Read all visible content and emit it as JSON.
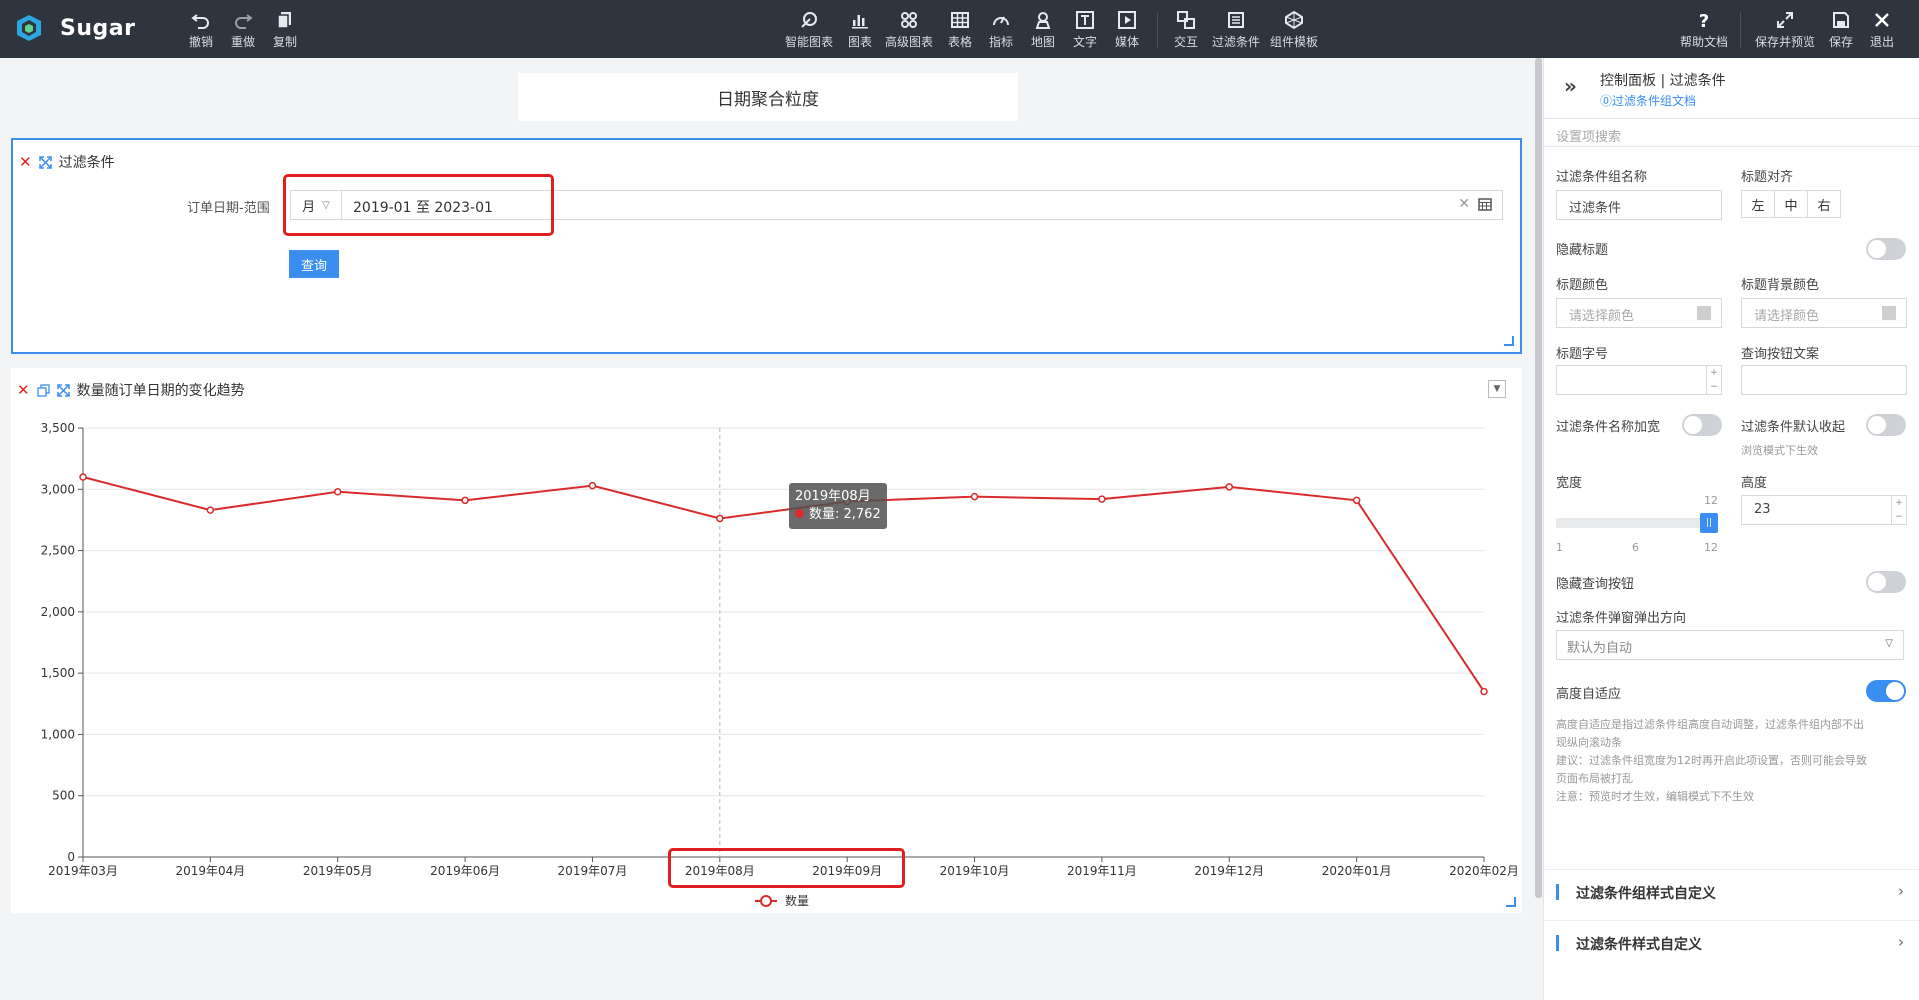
{
  "app": {
    "name": "Sugar"
  },
  "toolbar": {
    "left": [
      {
        "label": "撤销",
        "icon": "undo-icon"
      },
      {
        "label": "重做",
        "icon": "redo-icon"
      },
      {
        "label": "复制",
        "icon": "copy-icon"
      }
    ],
    "center": [
      {
        "label": "智能图表",
        "icon": "smart-chart-icon"
      },
      {
        "label": "图表",
        "icon": "bar-chart-icon"
      },
      {
        "label": "高级图表",
        "icon": "advanced-chart-icon"
      },
      {
        "label": "表格",
        "icon": "table-icon"
      },
      {
        "label": "指标",
        "icon": "gauge-icon"
      },
      {
        "label": "地图",
        "icon": "map-pin-icon"
      },
      {
        "label": "文字",
        "icon": "text-icon"
      },
      {
        "label": "媒体",
        "icon": "media-icon"
      },
      {
        "label": "交互",
        "icon": "interaction-icon"
      },
      {
        "label": "过滤条件",
        "icon": "filter-icon"
      },
      {
        "label": "组件模板",
        "icon": "template-icon"
      }
    ],
    "right": [
      {
        "label": "帮助文档",
        "icon": "help-icon"
      },
      {
        "label": "保存并预览",
        "icon": "expand-icon"
      },
      {
        "label": "保存",
        "icon": "save-icon"
      },
      {
        "label": "退出",
        "icon": "close-icon"
      }
    ]
  },
  "title_card": {
    "text": "日期聚合粒度"
  },
  "filter_card": {
    "title": "过滤条件",
    "field_label": "订单日期-范围",
    "granularity": "月",
    "range_value": "2019-01 至 2023-01",
    "query_button": "查询"
  },
  "chart_card": {
    "title": "数量随订单日期的变化趋势"
  },
  "chart_data": {
    "type": "line",
    "x": [
      "2019年03月",
      "2019年04月",
      "2019年05月",
      "2019年06月",
      "2019年07月",
      "2019年08月",
      "2019年09月",
      "2019年10月",
      "2019年11月",
      "2019年12月",
      "2020年01月",
      "2020年02月"
    ],
    "y_ticks": [
      "0",
      "500",
      "1,000",
      "1,500",
      "2,000",
      "2,500",
      "3,000",
      "3,500"
    ],
    "ylim": [
      0,
      3500
    ],
    "series": [
      {
        "name": "数量",
        "color": "#d92b2b",
        "values": [
          3100,
          2830,
          2980,
          2910,
          3030,
          2762,
          2900,
          2940,
          2920,
          3020,
          2910,
          1350
        ]
      }
    ],
    "legend_position": "bottom-center",
    "grid": true,
    "tooltip": {
      "title": "2019年08月",
      "line": "数量: 2,762"
    }
  },
  "panel": {
    "header_title": "控制面板 | 过滤条件",
    "doc_link": "⓪过滤条件组文档",
    "search_placeholder": "设置项搜索",
    "group_name_label": "过滤条件组名称",
    "group_name_value": "过滤条件",
    "title_align_label": "标题对齐",
    "align_options": [
      "左",
      "中",
      "右"
    ],
    "hide_title_label": "隐藏标题",
    "title_color_label": "标题颜色",
    "title_bg_color_label": "标题背景颜色",
    "color_placeholder": "请选择颜色",
    "title_font_label": "标题字号",
    "query_btn_text_label": "查询按钮文案",
    "name_bold_label": "过滤条件名称加宽",
    "default_collapse_label": "过滤条件默认收起",
    "collapse_hint": "浏览模式下生效",
    "width_label": "宽度",
    "height_label": "高度",
    "height_value": "23",
    "width_value": "12",
    "slider_marks": [
      "1",
      "6",
      "12"
    ],
    "hide_query_label": "隐藏查询按钮",
    "popup_dir_label": "过滤条件弹窗弹出方向",
    "popup_dir_value": "默认为自动",
    "auto_height_label": "高度自适应",
    "notes": [
      "高度自适应是指过滤条件组高度自动调整，过滤条件组内部不出",
      "现纵向滚动条",
      "建议：过滤条件组宽度为12时再开启此项设置，否则可能会导致",
      "页面布局被打乱",
      "注意：预览时才生效，编辑模式下不生效"
    ],
    "sections": [
      "过滤条件组样式自定义",
      "过滤条件样式自定义"
    ]
  }
}
